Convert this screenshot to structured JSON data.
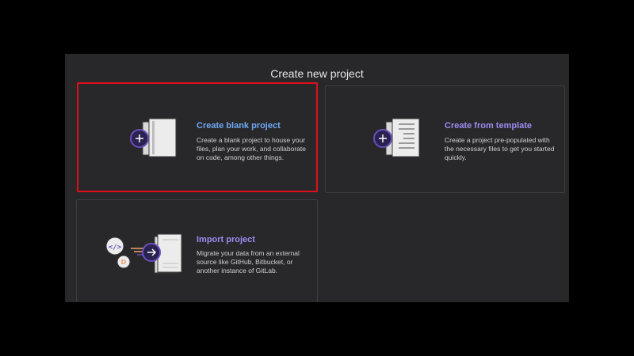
{
  "page": {
    "title": "Create new project"
  },
  "colors": {
    "background": "#000000",
    "panel": "#28282b",
    "card_border": "#3d3d42",
    "selected_border": "#e0101a",
    "link_blue": "#6ea8f4",
    "link_purple": "#9c8cf0",
    "icon_accent": "#6b4fbb",
    "icon_orange": "#f0a070"
  },
  "options": [
    {
      "title": "Create blank project",
      "description": "Create a blank project to house your files, plan your work, and collaborate on code, among other things.",
      "icon": "blank-project-icon",
      "selected": true
    },
    {
      "title": "Create from template",
      "description": "Create a project pre-populated with the necessary files to get you started quickly.",
      "icon": "template-project-icon",
      "selected": false
    },
    {
      "title": "Import project",
      "description": "Migrate your data from an external source like GitHub, Bitbucket, or another instance of GitLab.",
      "icon": "import-project-icon",
      "selected": false
    }
  ]
}
